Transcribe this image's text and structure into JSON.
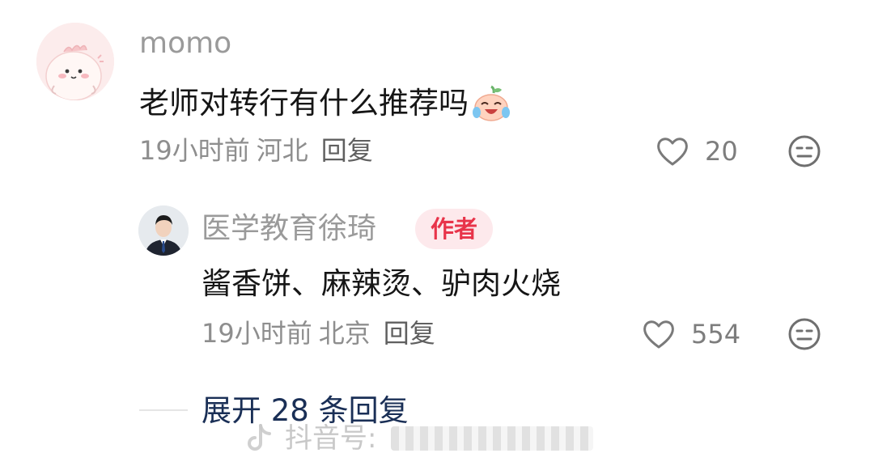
{
  "comment": {
    "username": "momo",
    "text": "老师对转行有什么推荐吗",
    "emoji_icon": "laughing-tears-peach-emoji",
    "time": "19小时前",
    "location": "河北",
    "reply_label": "回复",
    "likes": "20"
  },
  "reply": {
    "username": "医学教育徐琦",
    "badge": "作者",
    "text": "酱香饼、麻辣烫、驴肉火烧",
    "time": "19小时前",
    "location": "北京",
    "reply_label": "回复",
    "likes": "554"
  },
  "expand": {
    "label": "展开 28 条回复"
  },
  "watermark": {
    "text": "抖音号:"
  },
  "colors": {
    "badge_bg": "#fde9ec",
    "badge_text": "#e8344a",
    "expand_text": "#1a2f56",
    "meta_text": "#8e8e8e"
  }
}
